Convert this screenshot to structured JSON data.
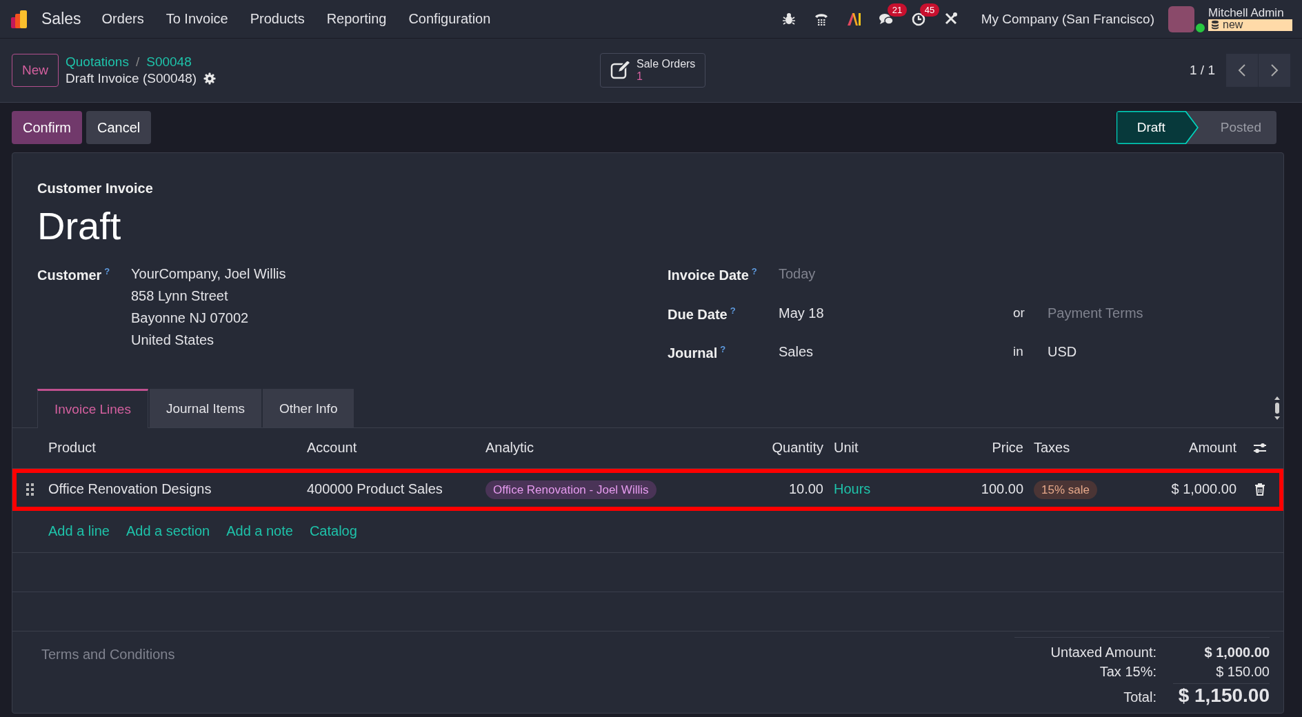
{
  "navbar": {
    "app_name": "Sales",
    "menu": [
      "Orders",
      "To Invoice",
      "Products",
      "Reporting",
      "Configuration"
    ],
    "systray": [
      {
        "kind": "bug"
      },
      {
        "kind": "phone"
      },
      {
        "kind": "ai"
      },
      {
        "kind": "chat",
        "badge": "21"
      },
      {
        "kind": "clock",
        "badge": "45"
      },
      {
        "kind": "tools"
      }
    ],
    "company": "My Company (San Francisco)",
    "user": {
      "name": "Mitchell Admin",
      "database": "new",
      "online": true
    }
  },
  "control_panel": {
    "new_button": "New",
    "breadcrumbs": [
      "Quotations",
      "S00048"
    ],
    "breadcrumb_separator": "/",
    "record_title": "Draft Invoice (S00048)",
    "smart_button": {
      "label": "Sale Orders",
      "count": "1"
    },
    "pager": "1 / 1"
  },
  "actions": [
    {
      "label": "Confirm",
      "kind": "primary"
    },
    {
      "label": "Cancel",
      "kind": "secondary"
    }
  ],
  "status_steps": [
    {
      "label": "Draft",
      "selected": true
    },
    {
      "label": "Posted",
      "selected": false
    }
  ],
  "form": {
    "type_label": "Customer Invoice",
    "title": "Draft",
    "customer": {
      "label": "Customer",
      "help": "?",
      "lines": [
        "YourCompany, Joel Willis",
        "858 Lynn Street",
        "Bayonne NJ 07002",
        "United States"
      ]
    },
    "fields": [
      {
        "label": "Invoice Date",
        "help": "?",
        "placeholder": "Today"
      },
      {
        "label": "Due Date",
        "help": "?",
        "value": "May 18",
        "joiner": "or",
        "extra_placeholder": "Payment Terms"
      },
      {
        "label": "Journal",
        "help": "?",
        "value": "Sales",
        "joiner": "in",
        "extra_value": "USD"
      }
    ]
  },
  "tabs": [
    {
      "label": "Invoice Lines",
      "selected": true
    },
    {
      "label": "Journal Items",
      "selected": false
    },
    {
      "label": "Other Info",
      "selected": false
    }
  ],
  "table": {
    "columns": [
      {
        "label": "Product",
        "kind": "text"
      },
      {
        "label": "Account",
        "kind": "text"
      },
      {
        "label": "Analytic",
        "kind": "text"
      },
      {
        "label": "Quantity",
        "kind": "numeric"
      },
      {
        "label": "Unit",
        "kind": "text"
      },
      {
        "label": "Price",
        "kind": "numeric"
      },
      {
        "label": "Taxes",
        "kind": "text"
      },
      {
        "label": "Amount",
        "kind": "numeric"
      }
    ],
    "rows": [
      {
        "highlighted": true,
        "cells": [
          {
            "kind": "text",
            "text": "Office Renovation Designs"
          },
          {
            "kind": "text",
            "text": "400000 Product Sales"
          },
          {
            "kind": "analytic-tag",
            "text": "Office Renovation - Joel Willis"
          },
          {
            "kind": "number",
            "text": "10.00"
          },
          {
            "kind": "link",
            "text": "Hours"
          },
          {
            "kind": "number",
            "text": "100.00"
          },
          {
            "kind": "tax-tag",
            "text": "15% sale"
          },
          {
            "kind": "number",
            "text": "$ 1,000.00"
          }
        ]
      }
    ],
    "add_links": [
      "Add a line",
      "Add a section",
      "Add a note",
      "Catalog"
    ]
  },
  "terms_placeholder": "Terms and Conditions",
  "totals": [
    {
      "label": "Untaxed Amount:",
      "value": "$ 1,000.00",
      "kind": "subtotal"
    },
    {
      "label": "Tax 15%:",
      "value": "$ 150.00",
      "kind": "tax"
    },
    {
      "label": "Total:",
      "value": "$ 1,150.00",
      "kind": "total"
    }
  ]
}
